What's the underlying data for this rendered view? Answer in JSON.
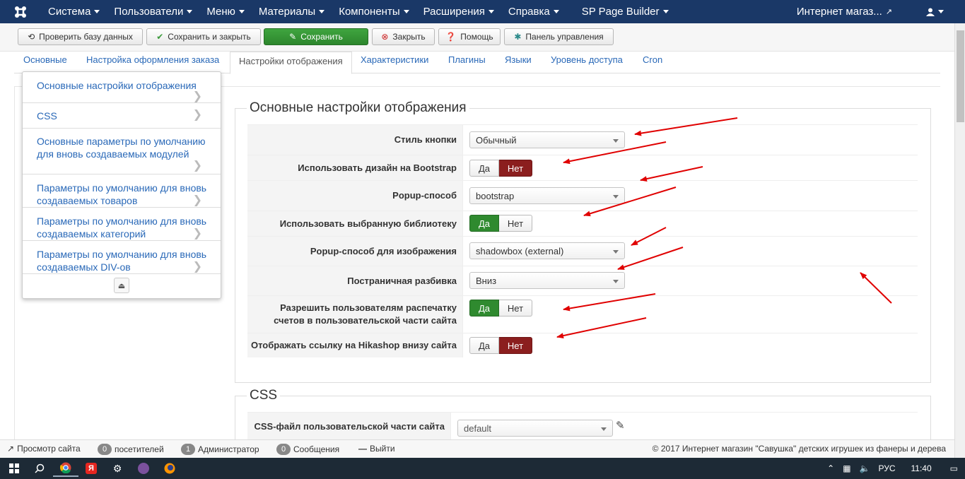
{
  "navbar": {
    "menu": [
      "Система",
      "Пользователи",
      "Меню",
      "Материалы",
      "Компоненты",
      "Расширения",
      "Справка",
      "SP Page Builder"
    ],
    "site_link": "Интернет магаз..."
  },
  "toolbar": {
    "check_db": "Проверить базу данных",
    "save_close": "Сохранить и закрыть",
    "save": "Сохранить",
    "close": "Закрыть",
    "help": "Помощь",
    "control_panel": "Панель управления"
  },
  "tabs": [
    "Основные",
    "Настройка оформления заказа",
    "Настройки отображения",
    "Характеристики",
    "Плагины",
    "Языки",
    "Уровень доступа",
    "Cron"
  ],
  "sidemenu": [
    "Основные настройки отображения",
    "CSS",
    "Основные параметры по умолчанию для вновь создаваемых модулей",
    "Параметры по умолчанию для вновь создаваемых товаров",
    "Параметры по умолчанию для вновь создаваемых категорий",
    "Параметры по умолчанию для вновь создаваемых DIV-ов"
  ],
  "section_main": {
    "legend": "Основные настройки отображения",
    "rows": [
      {
        "label": "Стиль кнопки",
        "type": "select",
        "value": "Обычный"
      },
      {
        "label": "Использовать дизайн на Bootstrap",
        "type": "toggle",
        "yes": "Да",
        "no": "Нет",
        "selected": "no"
      },
      {
        "label": "Popup-способ",
        "type": "select",
        "value": "bootstrap"
      },
      {
        "label": "Использовать выбранную библиотеку",
        "type": "toggle",
        "yes": "Да",
        "no": "Нет",
        "selected": "yes"
      },
      {
        "label": "Popup-способ для изображения",
        "type": "select",
        "value": "shadowbox (external)"
      },
      {
        "label": "Постраничная разбивка",
        "type": "select",
        "value": "Вниз"
      },
      {
        "label": "Разрешить пользователям распечатку счетов в пользовательской части сайта",
        "type": "toggle",
        "yes": "Да",
        "no": "Нет",
        "selected": "yes"
      },
      {
        "label": "Отображать ссылку на Hikashop внизу сайта",
        "type": "toggle",
        "yes": "Да",
        "no": "Нет",
        "selected": "no"
      }
    ]
  },
  "section_css": {
    "legend": "CSS",
    "row": {
      "label": "CSS-файл пользовательской части сайта",
      "value": "default"
    }
  },
  "statusbar": {
    "view_site": "Просмотр сайта",
    "visitors_count": "0",
    "visitors": "посетителей",
    "admins_count": "1",
    "admins": "Администратор",
    "messages_count": "0",
    "messages": "Сообщения",
    "logout": "Выйти",
    "copyright": "© 2017 Интернет магазин \"Савушка\" детских игрушек из фанеры и дерева"
  },
  "taskbar": {
    "lang": "РУС",
    "time": "11:40"
  },
  "colors": {
    "navbar": "#1a3867",
    "green": "#2f8a2f",
    "red": "#8b1e1e",
    "link": "#2a69b8",
    "arrow": "#e00000"
  }
}
